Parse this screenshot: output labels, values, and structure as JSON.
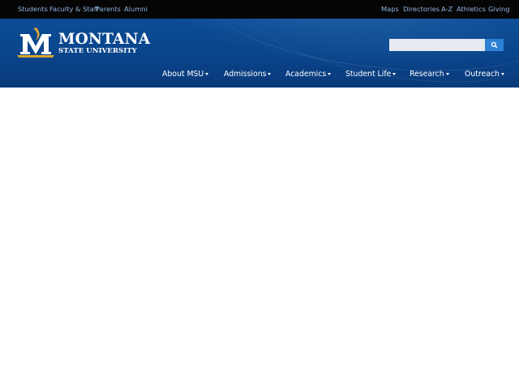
{
  "utility_nav": {
    "left": [
      "Students",
      "Faculty & Staff",
      "Parents",
      "Alumni"
    ],
    "right": [
      "Maps",
      "Directories",
      "A-Z",
      "Athletics",
      "Giving"
    ]
  },
  "logo": {
    "line1": "MONTANA",
    "line2": "STATE UNIVERSITY"
  },
  "search": {
    "placeholder": "",
    "button_icon": "search-icon"
  },
  "main_nav": [
    {
      "label": "About MSU",
      "icon": "caret-down-icon"
    },
    {
      "label": "Admissions",
      "icon": "caret-down-icon"
    },
    {
      "label": "Academics",
      "icon": "caret-down-icon"
    },
    {
      "label": "Student Life",
      "icon": "caret-down-icon"
    },
    {
      "label": "Research",
      "icon": "caret-down-icon"
    },
    {
      "label": "Outreach",
      "icon": "caret-down-icon"
    }
  ],
  "colors": {
    "topbar_bg": "#050505",
    "topbar_link": "#8fb4de",
    "header_blue": "#0a448a",
    "search_button": "#2e82d4",
    "logo_gold": "#d8a531"
  }
}
